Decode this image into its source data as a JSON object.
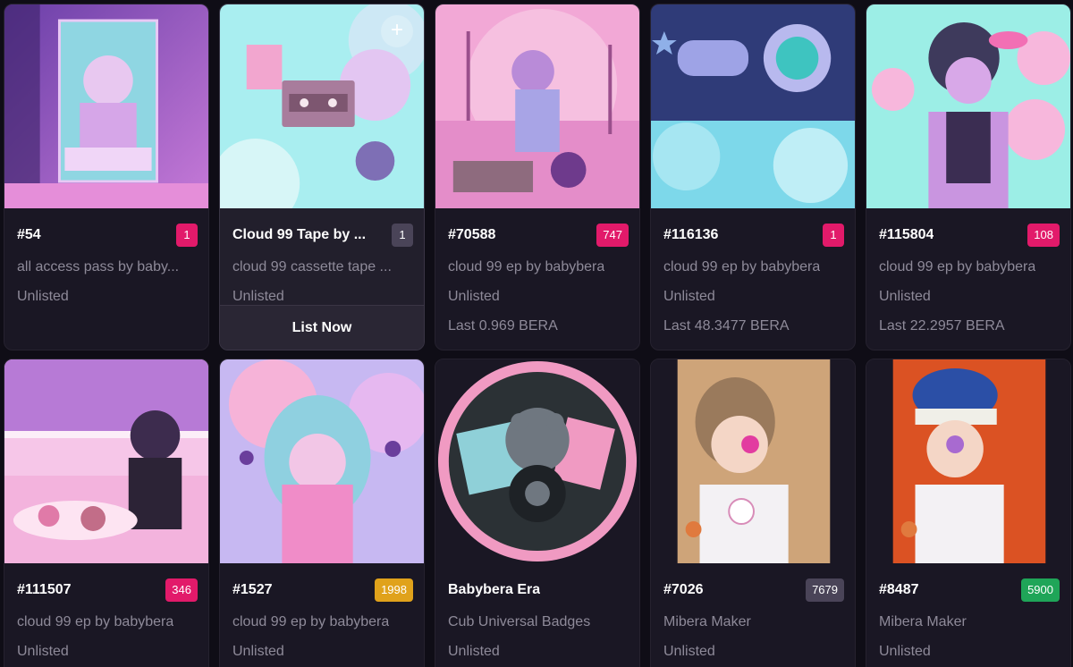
{
  "colors": {
    "badge_pink": "#e21a6a",
    "badge_gray": "#4a4458",
    "badge_yellow": "#e0a21b",
    "badge_green": "#1fa558"
  },
  "cards": [
    {
      "title": "#54",
      "badge": "1",
      "subtitle": "all access pass by baby...",
      "status": "Unlisted",
      "last": ""
    },
    {
      "title": "Cloud 99 Tape by ...",
      "badge": "1",
      "subtitle": "cloud 99 cassette tape ...",
      "status": "Unlisted",
      "action": "List Now",
      "plus_icon": "+"
    },
    {
      "title": "#70588",
      "badge": "747",
      "subtitle": "cloud 99 ep by babybera",
      "status": "Unlisted",
      "last": "Last 0.969 BERA"
    },
    {
      "title": "#116136",
      "badge": "1",
      "subtitle": "cloud 99 ep by babybera",
      "status": "Unlisted",
      "last": "Last 48.3477 BERA"
    },
    {
      "title": "#115804",
      "badge": "108",
      "subtitle": "cloud 99 ep by babybera",
      "status": "Unlisted",
      "last": "Last 22.2957 BERA"
    },
    {
      "title": "#111507",
      "badge": "346",
      "subtitle": "cloud 99 ep by babybera",
      "status": "Unlisted"
    },
    {
      "title": "#1527",
      "badge": "1998",
      "subtitle": "cloud 99 ep by babybera",
      "status": "Unlisted"
    },
    {
      "title": "Babybera Era",
      "badge": "",
      "subtitle": "Cub Universal Badges",
      "status": "Unlisted"
    },
    {
      "title": "#7026",
      "badge": "7679",
      "subtitle": "Mibera Maker",
      "status": "Unlisted"
    },
    {
      "title": "#8487",
      "badge": "5900",
      "subtitle": "Mibera Maker",
      "status": "Unlisted"
    }
  ]
}
